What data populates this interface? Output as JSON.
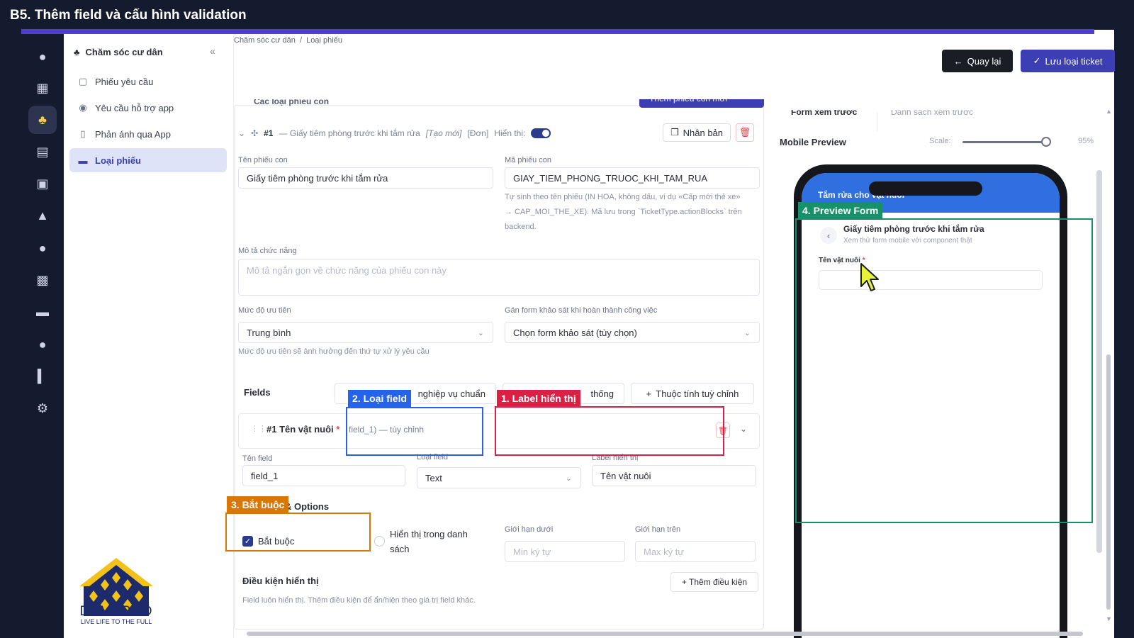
{
  "banner": {
    "title": "B5. Thêm field và cấu hình validation"
  },
  "sidebar": {
    "header": "Chăm sóc cư dân",
    "items": [
      {
        "label": "Phiếu yêu cầu",
        "icon": "ticket-icon"
      },
      {
        "label": "Yêu cầu hỗ trợ app",
        "icon": "support-icon"
      },
      {
        "label": "Phản ánh qua App",
        "icon": "phone-icon"
      },
      {
        "label": "Loại phiếu",
        "icon": "card-icon",
        "active": true
      }
    ]
  },
  "logo": {
    "name": "DEMEPRO",
    "tagline": "LIVE LIFE TO THE FULL"
  },
  "breadcrumb": {
    "root": "Chăm sóc cư dân",
    "sep": "/",
    "current": "Loại phiếu"
  },
  "toolbar": {
    "back_label": "Quay lại",
    "save_label": "Lưu loại ticket"
  },
  "cut_row": {
    "section_label": "Các loại phiếu con",
    "add_button": "Thêm phiếu con mới"
  },
  "sub_ticket": {
    "number": "#1",
    "summary": "— Giấy tiêm phòng trước khi tắm rửa",
    "tag_new": "[Tạo mới]",
    "tag_type": "[Đơn]",
    "visible_label": "Hiển thị:",
    "duplicate_label": "Nhân bản",
    "name_label": "Tên phiếu con",
    "name_value": "Giấy tiêm phòng trước khi tắm rửa",
    "code_label": "Mã phiếu con",
    "code_value": "GIAY_TIEM_PHONG_TRUOC_KHI_TAM_RUA",
    "code_help_1": "Tự sinh theo tên phiếu (IN HOA, không dấu, ví dụ «Cấp mới thẻ xe»",
    "code_help_2": "→ CAP_MOI_THE_XE). Mã lưu trong `TicketType.actionBlocks` trên",
    "code_help_3": "backend.",
    "desc_label": "Mô tả chức năng",
    "desc_placeholder": "Mô tả ngắn gọn về chức năng của phiếu con này",
    "priority_label": "Mức độ ưu tiên",
    "priority_value": "Trung bình",
    "priority_help": "Mức độ ưu tiên sẽ ảnh hưởng đến thứ tự xử lý yêu cầu",
    "survey_label": "Gán form khảo sát khi hoàn thành công việc",
    "survey_value": "Chọn form khảo sát (tùy chọn)"
  },
  "fields": {
    "label": "Fields",
    "btn_business": "nghiệp vụ chuẩn",
    "btn_system": "thống",
    "btn_custom": "Thuộc tính tuỳ chỉnh",
    "item": {
      "title": "#1 Tên vật nuôi",
      "required_mark": "*",
      "sub": "field_1)  — tùy chỉnh",
      "name_label": "Tên field",
      "name_value": "field_1",
      "type_label": "Loại field",
      "type_value": "Text",
      "display_label": "Label hiển thị",
      "display_value": "Tên vật nuôi"
    },
    "options_title": "& Options",
    "required_label": "Bắt buộc",
    "show_in_list_label_1": "Hiển thị trong danh",
    "show_in_list_label_2": "sách",
    "min_label": "Giới hạn dưới",
    "min_placeholder": "Min ký tự",
    "max_label": "Giới hạn trên",
    "max_placeholder": "Max ký tự",
    "condition_title": "Điều kiện hiển thị",
    "condition_button": "+ Thêm điều kiện",
    "condition_help": "Field luôn hiển thị. Thêm điều kiện để ẩn/hiện theo giá trị field khác."
  },
  "callouts": {
    "label_display": "1. Label hiển thị",
    "field_type": "2. Loại field",
    "required": "3. Bắt buộc",
    "preview_form": "4. Preview Form"
  },
  "preview": {
    "tab_form": "Form xem trước",
    "tab_list": "Danh sách xem trước",
    "mobile_title": "Mobile Preview",
    "scale_label": "Scale:",
    "scale_value": "95%",
    "scale_level": 0.95,
    "app_header": "Tắm rửa cho vật nuôi",
    "form_title": "Giấy tiêm phòng trước khi tắm rửa",
    "form_sub": "Xem thử form mobile với component thật",
    "field_label": "Tên vật nuôi",
    "field_req": "*"
  },
  "colors": {
    "banner_bg": "#141b2e",
    "accent": "#3c3fb4",
    "callout_red": "#d92045",
    "callout_blue": "#2563eb",
    "callout_orange": "#d97706",
    "callout_green": "#16916a"
  }
}
